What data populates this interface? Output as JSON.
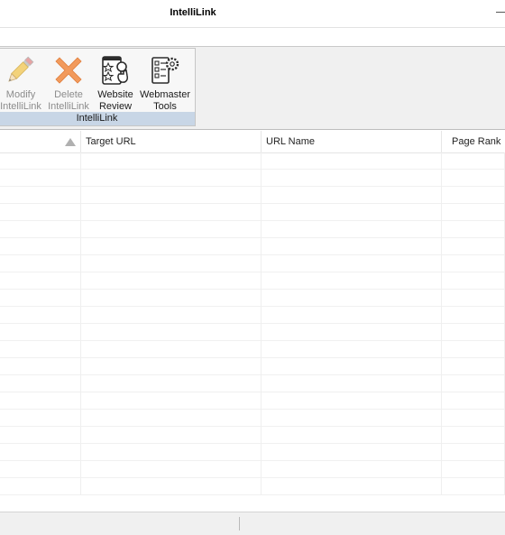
{
  "window": {
    "title": "IntelliLink"
  },
  "ribbon": {
    "group_label": "IntelliLink",
    "buttons": [
      {
        "id": "modify",
        "lines": [
          "Modify",
          "IntelliLink"
        ],
        "icon": "pencil-icon",
        "enabled": false
      },
      {
        "id": "delete",
        "lines": [
          "Delete",
          "IntelliLink"
        ],
        "icon": "delete-x-icon",
        "enabled": false
      },
      {
        "id": "review",
        "lines": [
          "Website",
          "Review"
        ],
        "icon": "website-review-icon",
        "enabled": true
      },
      {
        "id": "webmaster",
        "lines": [
          "Webmaster",
          "Tools"
        ],
        "icon": "webmaster-tools-icon",
        "enabled": true
      }
    ]
  },
  "grid": {
    "columns": [
      {
        "label": "",
        "sorted": "ascending"
      },
      {
        "label": "Target URL"
      },
      {
        "label": "URL Name"
      },
      {
        "label": "Page Rank"
      }
    ],
    "empty_rows": 20
  },
  "colors": {
    "ribbon_bg": "#f0f0f0",
    "group_label_bg": "#c8d6e6",
    "delete_icon": "#f29a5c",
    "disabled_text": "#8c8c8c"
  }
}
